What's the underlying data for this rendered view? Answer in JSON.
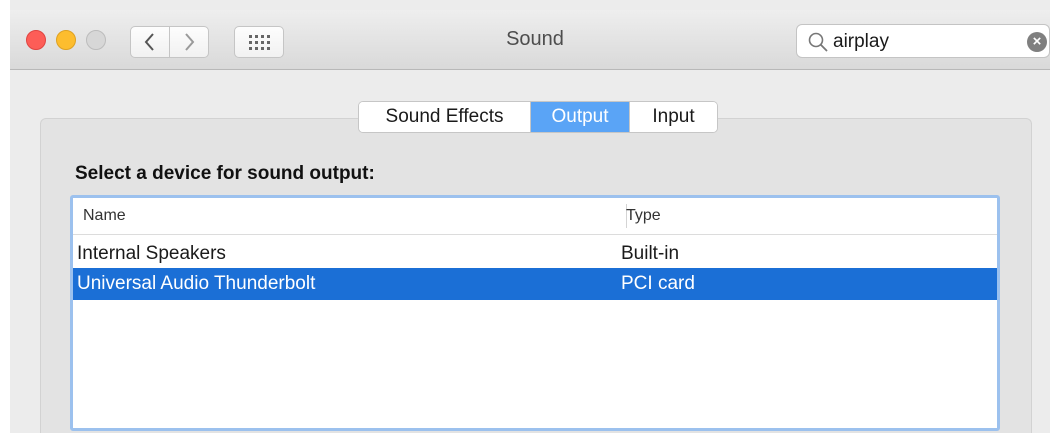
{
  "window": {
    "title": "Sound"
  },
  "search": {
    "value": "airplay"
  },
  "tabs": [
    {
      "label": "Sound Effects"
    },
    {
      "label": "Output",
      "selected": true
    },
    {
      "label": "Input"
    }
  ],
  "output": {
    "heading": "Select a device for sound output:",
    "columns": {
      "name": "Name",
      "type": "Type"
    },
    "rows": [
      {
        "name": "Internal Speakers",
        "type": "Built-in"
      },
      {
        "name": "Universal Audio Thunderbolt",
        "type": "PCI card",
        "selected": true
      }
    ]
  },
  "colors": {
    "selection": "#1b6fd6",
    "tab_selected": "#5aa4f6",
    "close": "#fd5d57",
    "minimize": "#fdbd2e",
    "zoom_disabled": "#d7d7d7"
  },
  "icons": [
    "chevron-left-icon",
    "chevron-right-icon",
    "grid-icon",
    "search-icon",
    "clear-icon"
  ]
}
